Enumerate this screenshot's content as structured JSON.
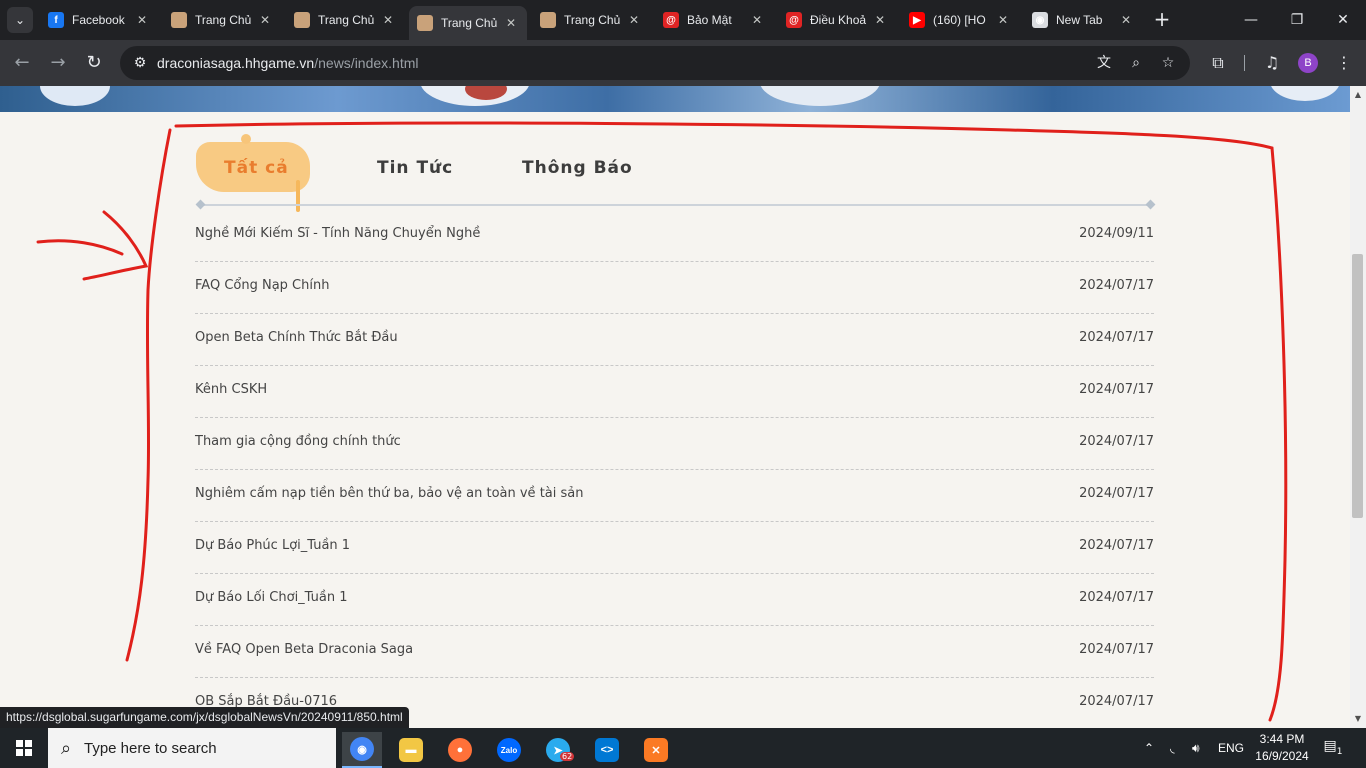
{
  "browser": {
    "tabs": [
      {
        "title": "Facebook",
        "icon": "facebook-icon",
        "color": "#1877f2",
        "glyph": "f",
        "active": false
      },
      {
        "title": "Trang Chủ",
        "icon": "game-favicon",
        "color": "#c9a27a",
        "glyph": "",
        "active": false
      },
      {
        "title": "Trang Chủ",
        "icon": "game-favicon",
        "color": "#c9a27a",
        "glyph": "",
        "active": false
      },
      {
        "title": "Trang Chủ",
        "icon": "game-favicon",
        "color": "#c9a27a",
        "glyph": "",
        "active": true
      },
      {
        "title": "Trang Chủ",
        "icon": "game-favicon",
        "color": "#c9a27a",
        "glyph": "",
        "active": false
      },
      {
        "title": "Bảo Mật",
        "icon": "spiral-red-icon",
        "color": "#e02424",
        "glyph": "@",
        "active": false
      },
      {
        "title": "Điều Khoả",
        "icon": "spiral-red-icon",
        "color": "#e02424",
        "glyph": "@",
        "active": false
      },
      {
        "title": "(160) [HO",
        "icon": "youtube-icon",
        "color": "#ff0000",
        "glyph": "▶",
        "active": false
      },
      {
        "title": "New Tab",
        "icon": "chrome-icon",
        "color": "#dadce0",
        "glyph": "◉",
        "active": false
      }
    ],
    "url_host": "draconiasaga.hhgame.vn",
    "url_path": "/news/index.html",
    "profile_initial": "B",
    "status_url": "https://dsglobal.sugarfungame.com/jx/dsglobalNewsVn/20240911/850.html"
  },
  "news": {
    "tabs": [
      {
        "label": "Tất cả",
        "active": true
      },
      {
        "label": "Tin Tức",
        "active": false
      },
      {
        "label": "Thông Báo",
        "active": false
      }
    ],
    "items": [
      {
        "title": "Nghề Mới Kiếm Sĩ - Tính Năng Chuyển Nghề",
        "date": "2024/09/11"
      },
      {
        "title": "FAQ Cổng Nạp Chính",
        "date": "2024/07/17"
      },
      {
        "title": "Open Beta Chính Thức Bắt Đầu",
        "date": "2024/07/17"
      },
      {
        "title": "Kênh CSKH",
        "date": "2024/07/17"
      },
      {
        "title": "Tham gia cộng đồng chính thức",
        "date": "2024/07/17"
      },
      {
        "title": "Nghiêm cấm nạp tiền bên thứ ba, bảo vệ an toàn về tài sản",
        "date": "2024/07/17"
      },
      {
        "title": "Dự Báo Phúc Lợi_Tuần 1",
        "date": "2024/07/17"
      },
      {
        "title": "Dự Báo Lối Chơi_Tuần 1",
        "date": "2024/07/17"
      },
      {
        "title": "Về FAQ Open Beta Draconia Saga",
        "date": "2024/07/17"
      },
      {
        "title": "OB Sắp Bắt Đầu-0716",
        "date": "2024/07/17"
      }
    ]
  },
  "taskbar": {
    "search_placeholder": "Type here to search",
    "apps": [
      {
        "name": "chrome",
        "color": "#4285f4",
        "glyph": "◉",
        "active": true
      },
      {
        "name": "file-explorer",
        "color": "#f2c744",
        "glyph": "▬",
        "active": false
      },
      {
        "name": "firefox",
        "color": "#ff7139",
        "glyph": "●",
        "active": false
      },
      {
        "name": "zalo",
        "color": "#0068ff",
        "glyph": "Zalo",
        "active": false
      },
      {
        "name": "telegram",
        "color": "#2aabee",
        "glyph": "➤",
        "active": false
      },
      {
        "name": "vscode",
        "color": "#0078d4",
        "glyph": "<>",
        "active": false
      },
      {
        "name": "xampp",
        "color": "#fb7a24",
        "glyph": "✕",
        "active": false
      }
    ],
    "telegram_badge": "62",
    "language": "ENG",
    "time": "3:44 PM",
    "date": "16/9/2024",
    "notification_count": "1"
  },
  "annotation_color": "#e0201b"
}
